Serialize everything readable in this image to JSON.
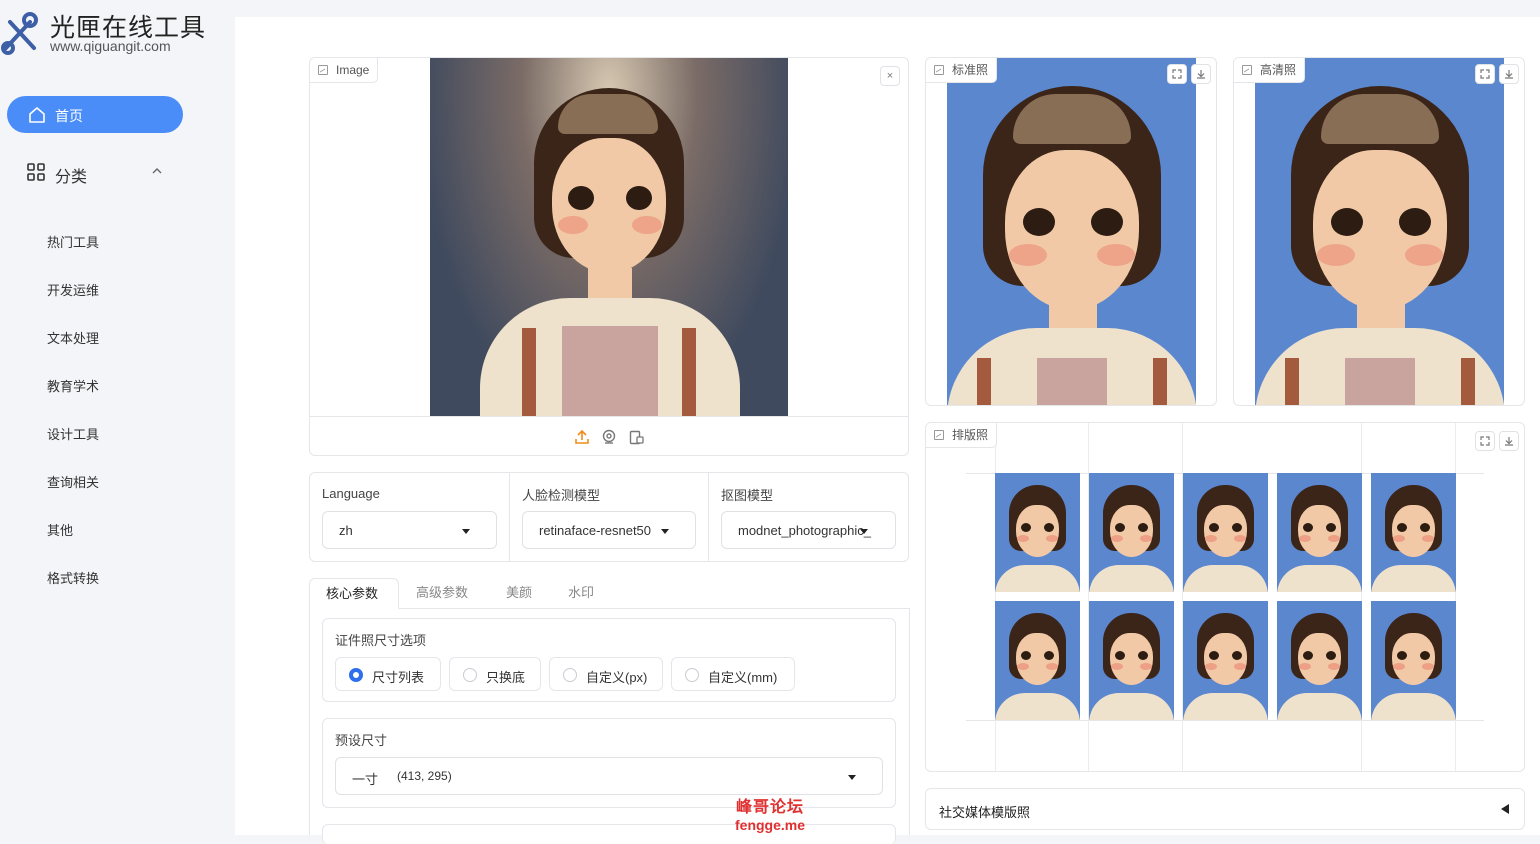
{
  "app": {
    "title": "光匣在线工具",
    "url": "www.qiguangit.com"
  },
  "sidebar": {
    "home_label": "首页",
    "category_label": "分类",
    "items": [
      "热门工具",
      "开发运维",
      "文本处理",
      "教育学术",
      "设计工具",
      "查询相关",
      "其他",
      "格式转换"
    ]
  },
  "image_panel": {
    "label": "Image",
    "clear_icon": "×"
  },
  "outputs": {
    "standard_label": "标准照",
    "hd_label": "高清照",
    "layout_label": "排版照",
    "social_label": "社交媒体模版照"
  },
  "settings": {
    "language_label": "Language",
    "language_value": "zh",
    "face_model_label": "人脸检测模型",
    "face_model_value": "retinaface-resnet50",
    "matting_model_label": "抠图模型",
    "matting_model_value": "modnet_photographic_"
  },
  "tabs": [
    "核心参数",
    "高级参数",
    "美颜",
    "水印"
  ],
  "size_options": {
    "label": "证件照尺寸选项",
    "options": [
      "尺寸列表",
      "只换底",
      "自定义(px)",
      "自定义(mm)"
    ],
    "selected": 0
  },
  "preset": {
    "label": "预设尺寸",
    "value_name": "一寸",
    "value_dims": "(413, 295)"
  },
  "watermark": {
    "line1": "峰哥论坛",
    "line2": "fengge.me"
  },
  "colors": {
    "accent": "#4b8df8",
    "photo_bg_blue": "#5b87cf",
    "upload_orange": "#f08c1a"
  }
}
